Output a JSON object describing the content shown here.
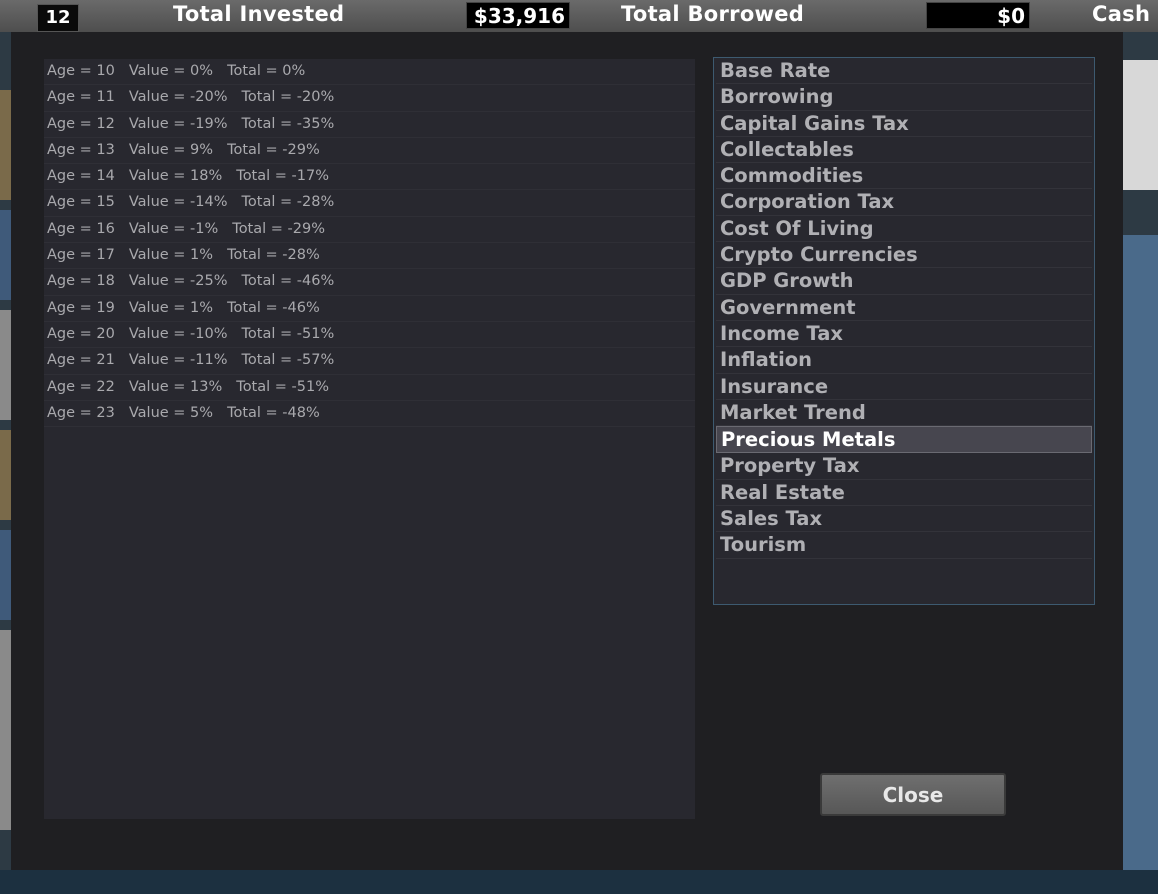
{
  "topbar": {
    "age_badge": "12",
    "total_invested_label": "Total Invested",
    "total_invested_value": "$33,916",
    "total_borrowed_label": "Total Borrowed",
    "total_borrowed_value": "$0",
    "cash_label": "Cash"
  },
  "history": {
    "rows": [
      {
        "age": "Age = 10",
        "value": "Value = 0%",
        "total": "Total = 0%"
      },
      {
        "age": "Age = 11",
        "value": "Value = -20%",
        "total": "Total = -20%"
      },
      {
        "age": "Age = 12",
        "value": "Value = -19%",
        "total": "Total = -35%"
      },
      {
        "age": "Age = 13",
        "value": "Value = 9%",
        "total": "Total = -29%"
      },
      {
        "age": "Age = 14",
        "value": "Value = 18%",
        "total": "Total = -17%"
      },
      {
        "age": "Age = 15",
        "value": "Value = -14%",
        "total": "Total = -28%"
      },
      {
        "age": "Age = 16",
        "value": "Value = -1%",
        "total": "Total = -29%"
      },
      {
        "age": "Age = 17",
        "value": "Value = 1%",
        "total": "Total = -28%"
      },
      {
        "age": "Age = 18",
        "value": "Value = -25%",
        "total": "Total = -46%"
      },
      {
        "age": "Age = 19",
        "value": "Value = 1%",
        "total": "Total = -46%"
      },
      {
        "age": "Age = 20",
        "value": "Value = -10%",
        "total": "Total = -51%"
      },
      {
        "age": "Age = 21",
        "value": "Value = -11%",
        "total": "Total = -57%"
      },
      {
        "age": "Age = 22",
        "value": "Value = 13%",
        "total": "Total = -51%"
      },
      {
        "age": "Age = 23",
        "value": "Value = 5%",
        "total": "Total = -48%"
      }
    ]
  },
  "categories": {
    "selected": "Precious Metals",
    "items": [
      "Base Rate",
      "Borrowing",
      "Capital Gains Tax",
      "Collectables",
      "Commodities",
      "Corporation Tax",
      "Cost Of Living",
      "Crypto Currencies",
      "GDP Growth",
      "Government",
      "Income Tax",
      "Inflation",
      "Insurance",
      "Market Trend",
      "Precious Metals",
      "Property Tax",
      "Real Estate",
      "Sales Tax",
      "Tourism"
    ]
  },
  "close_label": "Close",
  "colors": {
    "modal_bg": "#1f1f22",
    "panel_bg": "#28282f",
    "selected_bg": "#47464f",
    "list_border": "#3d5a70"
  }
}
